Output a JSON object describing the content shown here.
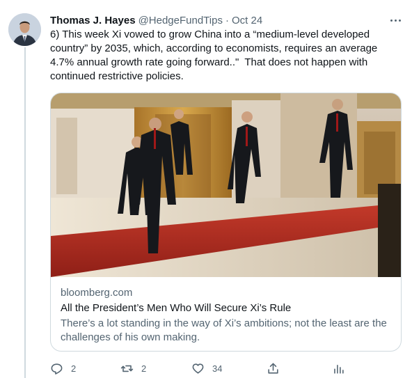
{
  "tweet": {
    "display_name": "Thomas J. Hayes",
    "handle": "@HedgeFundTips",
    "separator": "·",
    "date": "Oct 24",
    "text": "6) This week Xi vowed to grow China into a “medium-level developed country” by 2035, which, according to economists, requires an average 4.7% annual growth rate going forward..\"  That does not happen with continued restrictive policies."
  },
  "card": {
    "domain": "bloomberg.com",
    "title": "All the President’s Men Who Will Secure Xi’s Rule",
    "description": "There’s a lot standing in the way of Xi’s ambitions; not the least are the challenges of his own making."
  },
  "actions": {
    "reply": {
      "icon": "reply-icon",
      "count": "2"
    },
    "retweet": {
      "icon": "retweet-icon",
      "count": "2"
    },
    "like": {
      "icon": "heart-icon",
      "count": "34"
    },
    "share": {
      "icon": "share-icon"
    },
    "analytics": {
      "icon": "analytics-icon"
    }
  },
  "colors": {
    "text_primary": "#0f1419",
    "text_secondary": "#536471",
    "border": "#cfd9de"
  }
}
